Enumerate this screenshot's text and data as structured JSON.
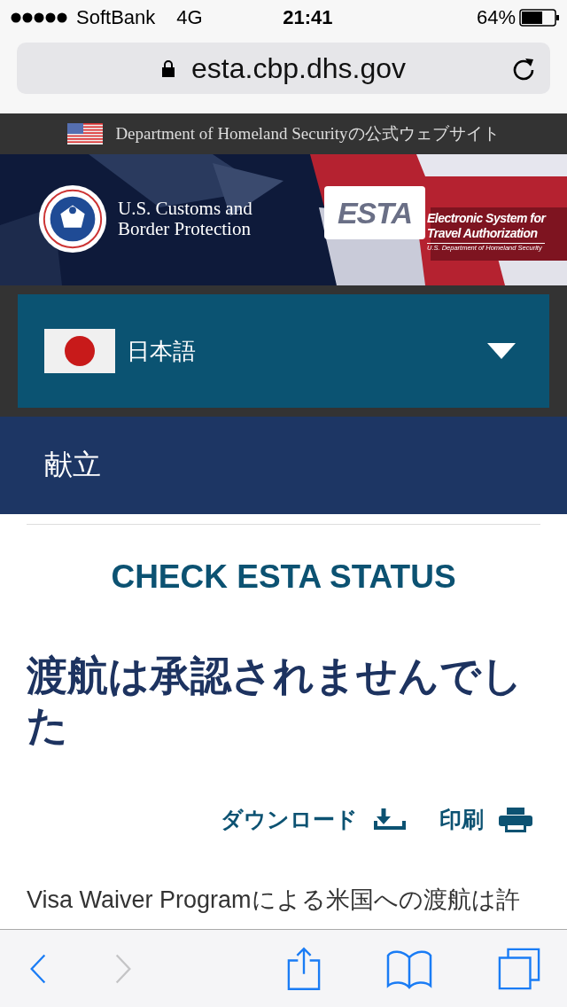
{
  "status_bar": {
    "carrier": "SoftBank",
    "network": "4G",
    "time": "21:41",
    "battery": "64%"
  },
  "address_bar": {
    "url": "esta.cbp.dhs.gov"
  },
  "gov_banner": {
    "text": "Department of Homeland Securityの公式ウェブサイト"
  },
  "header": {
    "kind": "picture",
    "agency_lines": [
      "U.S. Customs and",
      "Border Protection"
    ],
    "esta_logo": {
      "mark": "ESTA",
      "lines": [
        "Electronic System for",
        "Travel Authorization"
      ],
      "tagline": "U.S. Department of Homeland Security"
    }
  },
  "language_select": {
    "value": "日本語"
  },
  "menu": {
    "label": "献立"
  },
  "page": {
    "heading": "CHECK ESTA STATUS",
    "title": "渡航は承認されませんでした",
    "actions": [
      {
        "kind": "download",
        "label": "ダウンロード"
      },
      {
        "kind": "print",
        "label": "印刷"
      }
    ],
    "body": "Visa Waiver Programによる米国への渡航は許"
  },
  "toolbar": {
    "items": [
      {
        "kind": "back",
        "disabled": false
      },
      {
        "kind": "forward",
        "disabled": true
      },
      {
        "kind": "share",
        "disabled": false
      },
      {
        "kind": "bookmarks",
        "disabled": false
      },
      {
        "kind": "tabs",
        "disabled": false
      }
    ]
  }
}
